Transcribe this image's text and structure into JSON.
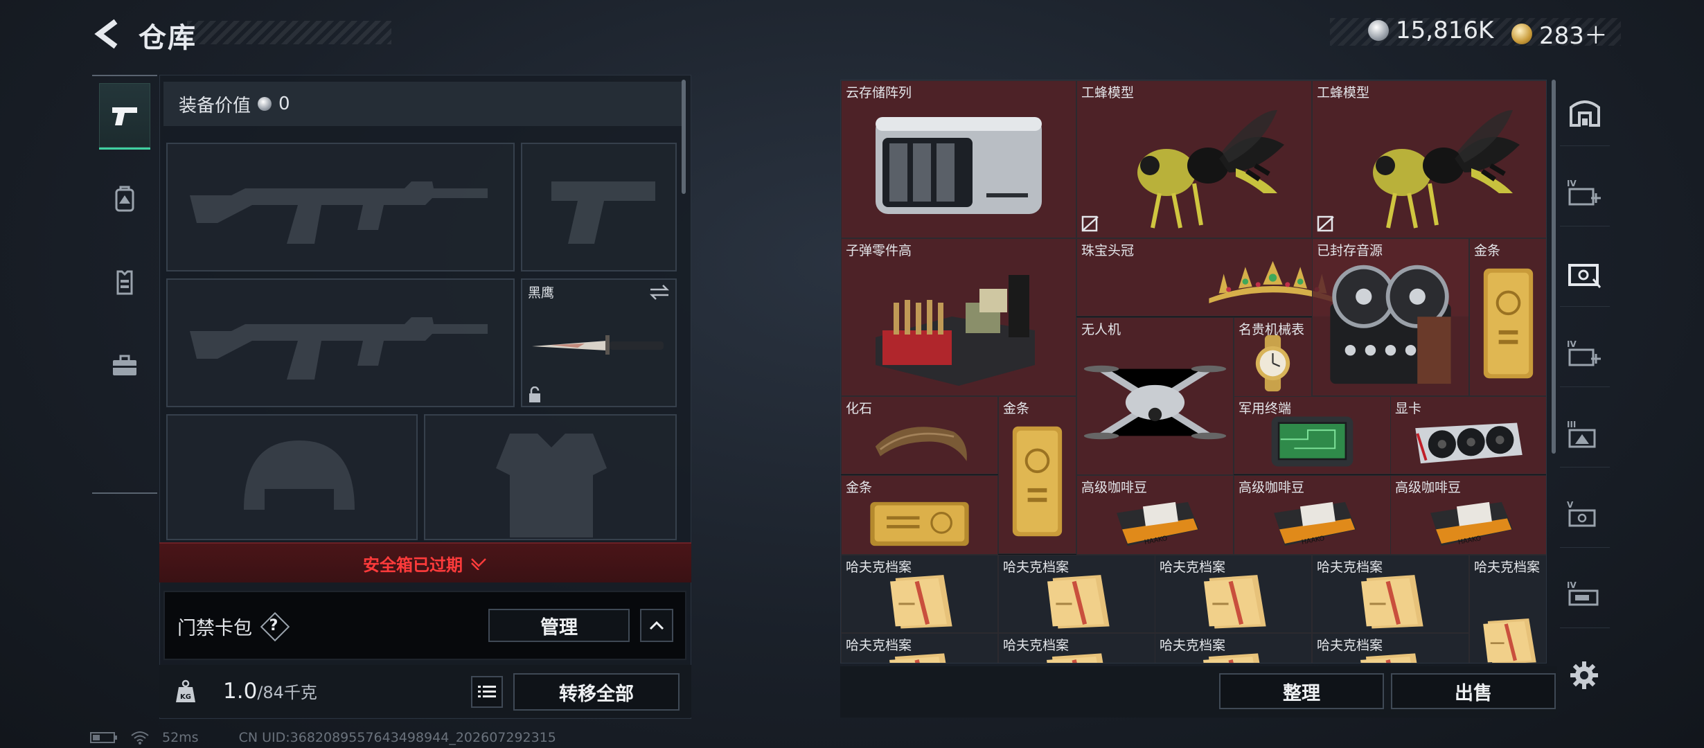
{
  "header": {
    "title": "仓库",
    "currency_silver": "15,816K",
    "currency_gold": "283＋"
  },
  "left_panel": {
    "equipment_value_label": "装备价值",
    "equipment_value": "0",
    "melee_slot_label": "黑鹰",
    "secure_case_status": "安全箱已过期",
    "keycard_label": "门禁卡包",
    "help_glyph": "?",
    "manage_label": "管理",
    "weight_value": "1.0",
    "weight_max": "/84千克",
    "transfer_all_label": "转移全部"
  },
  "status_bar": {
    "ping": "52ms",
    "uid": "CN UID:3682089557643498944_202607292315"
  },
  "stash": {
    "items": [
      {
        "label": "云存储阵列",
        "icon": "storage-array",
        "bg": "red"
      },
      {
        "label": "工蜂模型",
        "icon": "bee-model",
        "bg": "red",
        "locked": true
      },
      {
        "label": "工蜂模型",
        "icon": "bee-model",
        "bg": "red",
        "locked": true
      },
      {
        "label": "子弹零件高",
        "icon": "ammo-parts",
        "bg": "red"
      },
      {
        "label": "珠宝头冠",
        "icon": "jewel-crown",
        "bg": "red"
      },
      {
        "label": "已封存音源",
        "icon": "tape-recorder",
        "bg": "red"
      },
      {
        "label": "金条",
        "icon": "gold-bar",
        "bg": "red"
      },
      {
        "label": "无人机",
        "icon": "drone",
        "bg": "red"
      },
      {
        "label": "名贵机械表",
        "icon": "watch",
        "bg": "red"
      },
      {
        "label": "化石",
        "icon": "fossil",
        "bg": "red"
      },
      {
        "label": "金条",
        "icon": "gold-bar",
        "bg": "red"
      },
      {
        "label": "军用终端",
        "icon": "military-terminal",
        "bg": "red"
      },
      {
        "label": "显卡",
        "icon": "graphics-card",
        "bg": "red"
      },
      {
        "label": "金条",
        "icon": "gold-bar-flat",
        "bg": "red"
      },
      {
        "label": "高级咖啡豆",
        "icon": "coffee-beans",
        "bg": "red"
      },
      {
        "label": "高级咖啡豆",
        "icon": "coffee-beans",
        "bg": "red"
      },
      {
        "label": "高级咖啡豆",
        "icon": "coffee-beans",
        "bg": "red"
      },
      {
        "label": "哈夫克档案",
        "icon": "haavk-file",
        "bg": "grey"
      },
      {
        "label": "哈夫克档案",
        "icon": "haavk-file",
        "bg": "grey"
      },
      {
        "label": "哈夫克档案",
        "icon": "haavk-file",
        "bg": "grey"
      },
      {
        "label": "哈夫克档案",
        "icon": "haavk-file",
        "bg": "grey"
      },
      {
        "label": "哈夫克档案",
        "icon": "haavk-file",
        "bg": "grey"
      },
      {
        "label": "哈夫克档案",
        "icon": "haavk-file",
        "bg": "grey"
      },
      {
        "label": "哈夫克档案",
        "icon": "haavk-file",
        "bg": "grey"
      },
      {
        "label": "哈夫克档案",
        "icon": "haavk-file",
        "bg": "grey"
      },
      {
        "label": "哈夫克档案",
        "icon": "haavk-file",
        "bg": "grey"
      }
    ],
    "sort_label": "整理",
    "sell_label": "出售"
  },
  "colors": {
    "accent_green": "#3fd0a0",
    "warning_red": "#ff3b3b",
    "cell_red": "#58242a",
    "gold": "#c99b3a"
  }
}
